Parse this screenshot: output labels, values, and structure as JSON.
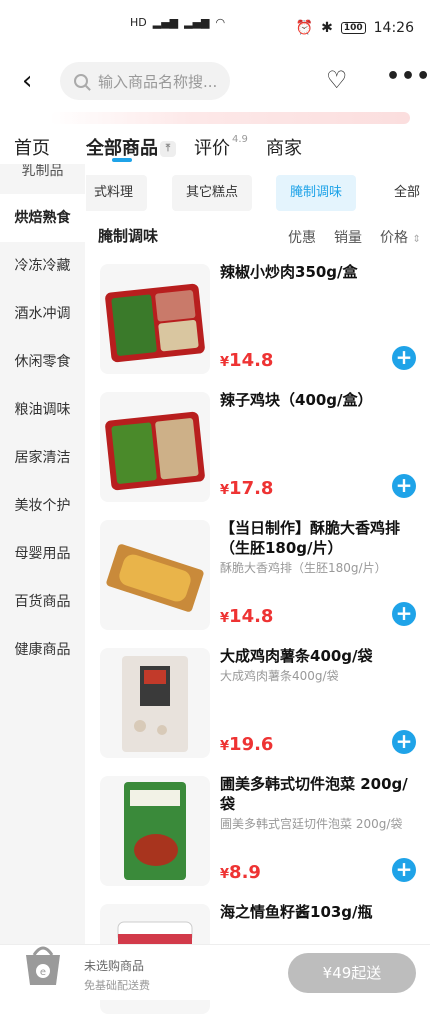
{
  "status": {
    "time": "14:26",
    "battery": "100",
    "network": "5G"
  },
  "search": {
    "placeholder": "输入商品名称搜..."
  },
  "tabs": [
    {
      "label": "首页"
    },
    {
      "label": "全部商品"
    },
    {
      "label": "评价",
      "sup": "4.9"
    },
    {
      "label": "商家"
    }
  ],
  "sidebar": {
    "items": [
      "乳制品",
      "烘焙熟食",
      "冷冻冷藏",
      "酒水冲调",
      "休闲零食",
      "粮油调味",
      "居家清洁",
      "美妆个护",
      "母婴用品",
      "百货商品",
      "健康商品"
    ],
    "active_index": 1
  },
  "subtabs": [
    "式料理",
    "其它糕点",
    "腌制调味",
    "全部"
  ],
  "list": {
    "title": "腌制调味",
    "sort": {
      "discount": "优惠",
      "sales": "销量",
      "price": "价格"
    }
  },
  "products": [
    {
      "name": "辣椒小炒肉350g/盒",
      "desc": "",
      "price": "14.8",
      "yen": "¥"
    },
    {
      "name": "辣子鸡块（400g/盒）",
      "desc": "",
      "price": "17.8",
      "yen": "¥"
    },
    {
      "name": "【当日制作】酥脆大香鸡排（生胚180g/片）",
      "desc": "酥脆大香鸡排（生胚180g/片）",
      "price": "14.8",
      "yen": "¥"
    },
    {
      "name": "大成鸡肉薯条400g/袋",
      "desc": "大成鸡肉薯条400g/袋",
      "price": "19.6",
      "yen": "¥"
    },
    {
      "name": "圃美多韩式切件泡菜 200g/袋",
      "desc": "圃美多韩式宫廷切件泡菜 200g/袋",
      "price": "8.9",
      "yen": "¥"
    },
    {
      "name": "海之情鱼籽酱103g/瓶",
      "desc": "",
      "price": "",
      "yen": ""
    }
  ],
  "bottom": {
    "cart_status": "未选购商品",
    "delivery": "免基础配送费",
    "min_order": "¥49起送"
  },
  "colors": {
    "accent": "#1fa3e8",
    "price": "#ee3333"
  }
}
